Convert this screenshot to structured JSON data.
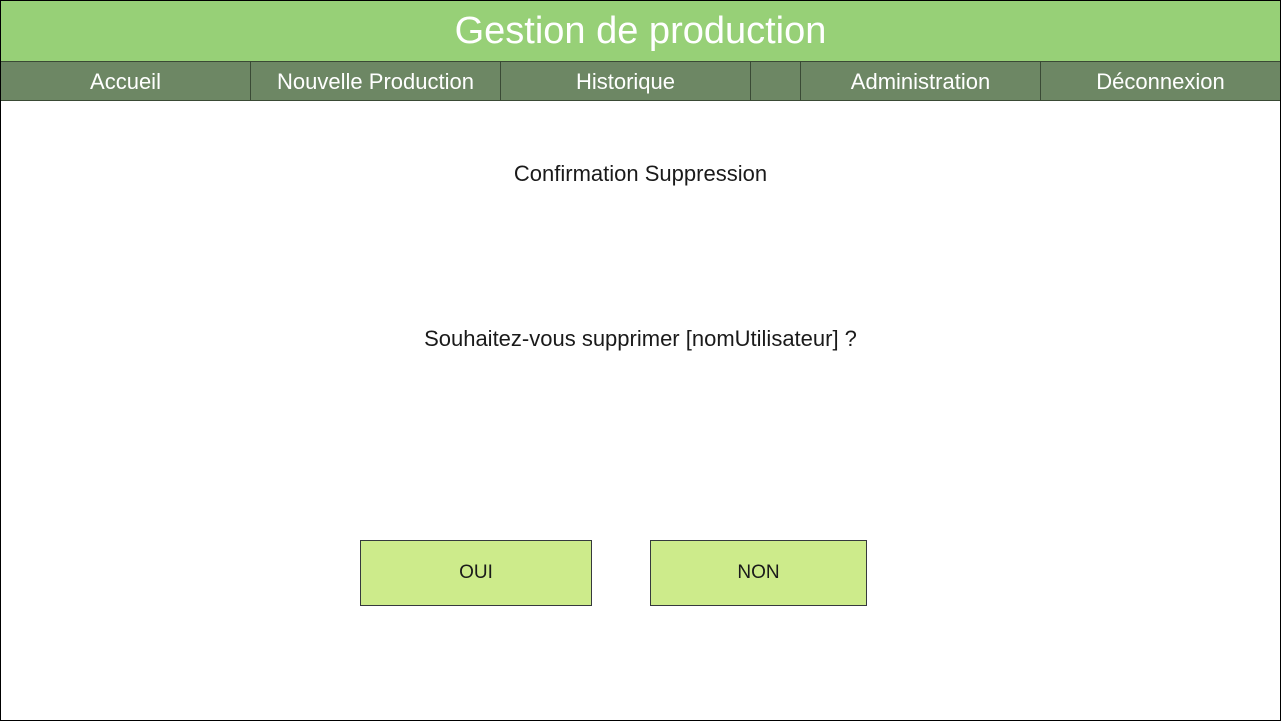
{
  "app": {
    "title": "Gestion de production"
  },
  "nav": {
    "items": [
      {
        "label": "Accueil"
      },
      {
        "label": "Nouvelle Production"
      },
      {
        "label": "Historique"
      },
      {
        "label": "Administration"
      },
      {
        "label": "Déconnexion"
      }
    ]
  },
  "dialog": {
    "title": "Confirmation Suppression",
    "message": "Souhaitez-vous supprimer [nomUtilisateur] ?",
    "yes_label": "OUI",
    "no_label": "NON"
  },
  "colors": {
    "header_bg": "#97d077",
    "nav_bg": "#6d8764",
    "button_bg": "#cdeb8b"
  }
}
